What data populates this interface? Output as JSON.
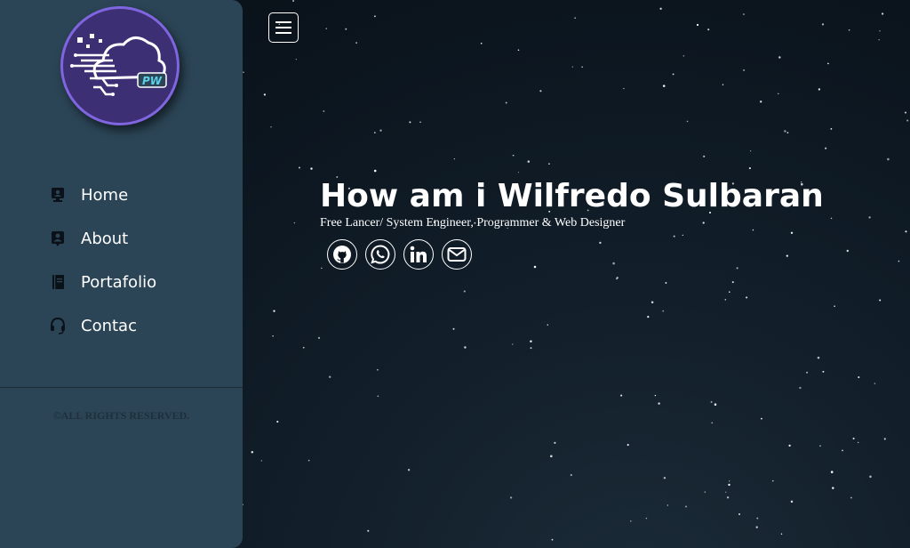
{
  "hero": {
    "title": "How am i Wilfredo Sulbaran",
    "subtitle": "Free Lancer/ System Engineer, Programmer & Web Designer"
  },
  "logo": {
    "text": "PW",
    "icon": "cloud-circuit-logo"
  },
  "nav": {
    "items": [
      {
        "label": "Home",
        "icon": "monitor-user-icon"
      },
      {
        "label": "About",
        "icon": "id-badge-icon"
      },
      {
        "label": "Portafolio",
        "icon": "book-icon"
      },
      {
        "label": "Contac",
        "icon": "headset-icon"
      }
    ]
  },
  "footer": {
    "copyright": "©ALL RIGHTS RESERVED."
  },
  "socials": [
    {
      "name": "GitHub",
      "icon": "github-icon"
    },
    {
      "name": "WhatsApp",
      "icon": "whatsapp-icon"
    },
    {
      "name": "LinkedIn",
      "icon": "linkedin-icon"
    },
    {
      "name": "Email",
      "icon": "envelope-icon"
    }
  ],
  "colors": {
    "sidebar": "#2b4556",
    "background": "#0a131c",
    "logo_fill": "#3d2f73",
    "logo_ring": "#8065e0",
    "text": "#ffffff"
  }
}
